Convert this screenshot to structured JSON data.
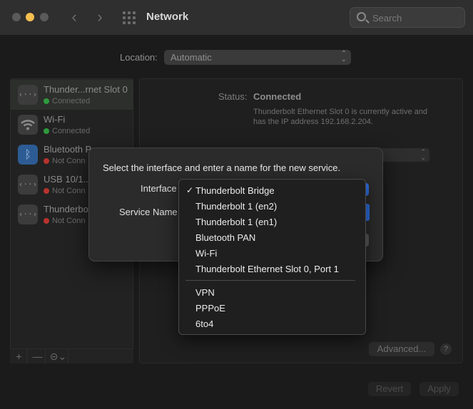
{
  "window": {
    "title": "Network"
  },
  "search": {
    "placeholder": "Search"
  },
  "location": {
    "label": "Location:",
    "value": "Automatic"
  },
  "services": [
    {
      "name": "Thunder...rnet Slot 0",
      "status": "Connected",
      "status_color": "#2f9a3c",
      "icon": "ethernet-icon"
    },
    {
      "name": "Wi-Fi",
      "status": "Connected",
      "status_color": "#2f9a3c",
      "icon": "wifi-icon"
    },
    {
      "name": "Bluetooth P",
      "status": "Not Conn",
      "status_color": "#b8322e",
      "icon": "bluetooth-icon"
    },
    {
      "name": "USB 10/1...",
      "status": "Not Conn",
      "status_color": "#b8322e",
      "icon": "ethernet-icon"
    },
    {
      "name": "Thunderbo",
      "status": "Not Conn",
      "status_color": "#b8322e",
      "icon": "ethernet-icon"
    }
  ],
  "sidebar_footer": {
    "add": "+",
    "remove": "—",
    "action": "⊝⌄"
  },
  "detail": {
    "status_label": "Status:",
    "status_value": "Connected",
    "status_desc": "Thunderbolt Ethernet Slot 0 is currently active and has the IP address 192.168.2.204.",
    "advanced": "Advanced...",
    "help": "?",
    "revert": "Revert",
    "apply": "Apply"
  },
  "sheet": {
    "prompt": "Select the interface and enter a name for the new service.",
    "interface_label": "Interface",
    "service_name_label": "Service Name"
  },
  "menu": {
    "selected_mark": "✓",
    "items": [
      "Thunderbolt Bridge",
      "Thunderbolt 1 (en2)",
      "Thunderbolt 1 (en1)",
      "Bluetooth PAN",
      "Wi-Fi",
      "Thunderbolt Ethernet Slot 0, Port 1",
      "VPN",
      "PPPoE",
      "6to4"
    ]
  }
}
